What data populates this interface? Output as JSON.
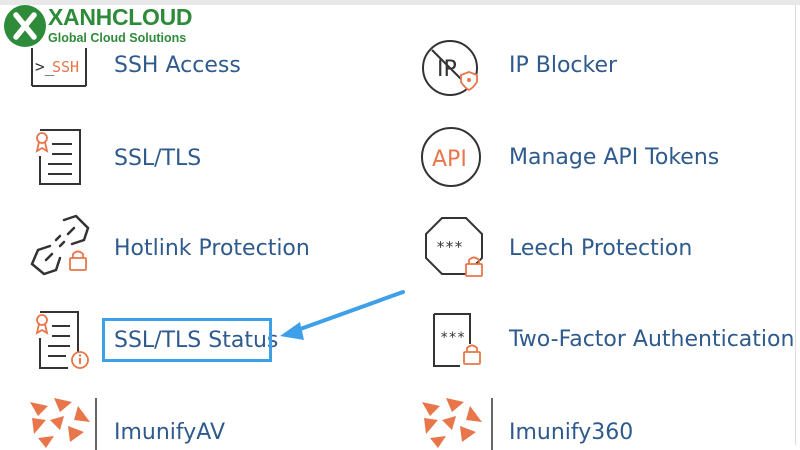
{
  "logo": {
    "name": "XANHCLOUD",
    "tagline": "Global Cloud Solutions"
  },
  "colors": {
    "link": "#2e5a8d",
    "accent": "#e8764a",
    "highlight": "#3ea0e8",
    "brand": "#2e8b3a"
  },
  "tools": {
    "ssh_access": {
      "label": "SSH Access",
      "icon": "ssh-terminal-icon",
      "icon_text": ">_SSH"
    },
    "ip_blocker": {
      "label": "IP Blocker",
      "icon": "ip-blocker-icon",
      "icon_text": "IP"
    },
    "ssl_tls": {
      "label": "SSL/TLS",
      "icon": "certificate-icon"
    },
    "manage_api_tokens": {
      "label": "Manage API Tokens",
      "icon": "api-icon",
      "icon_text": "API"
    },
    "hotlink_protection": {
      "label": "Hotlink Protection",
      "icon": "broken-link-lock-icon"
    },
    "leech_protection": {
      "label": "Leech Protection",
      "icon": "password-lock-icon",
      "icon_text": "***"
    },
    "ssl_tls_status": {
      "label": "SSL/TLS Status",
      "icon": "certificate-info-icon"
    },
    "two_factor_auth": {
      "label": "Two-Factor Authentication",
      "icon": "two-factor-lock-icon",
      "icon_text": "***"
    },
    "imunifyav": {
      "label": "ImunifyAV",
      "icon": "imunify-icon"
    },
    "imunify360": {
      "label": "Imunify360",
      "icon": "imunify-icon"
    }
  }
}
